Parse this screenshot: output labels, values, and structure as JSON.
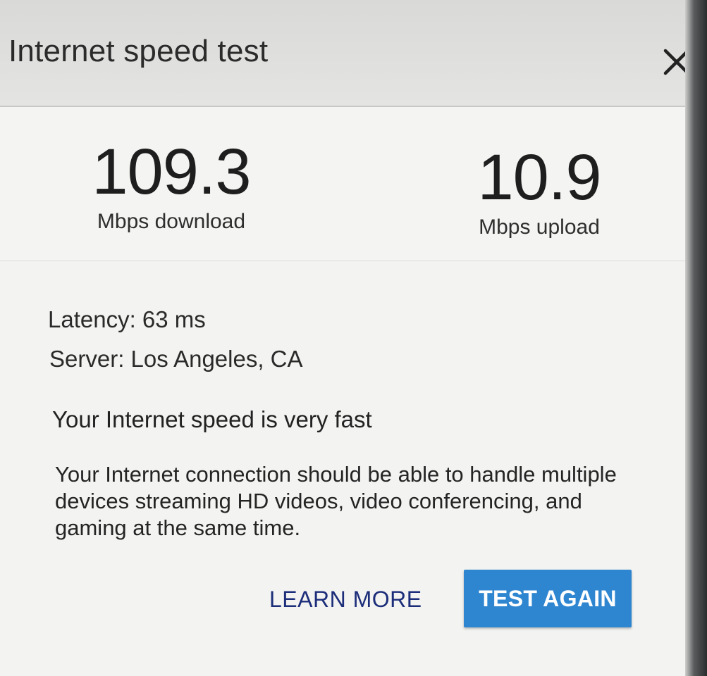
{
  "dialog": {
    "title": "Internet speed test",
    "close_icon": "close-icon"
  },
  "results": {
    "download": {
      "value": "109.3",
      "unit": "Mbps download"
    },
    "upload": {
      "value": "10.9",
      "unit": "Mbps upload"
    }
  },
  "details": {
    "latency": "Latency: 63 ms",
    "server": "Server: Los Angeles, CA",
    "verdict": "Your Internet speed is very fast",
    "description": "Your Internet connection should be able to handle multiple devices streaming HD videos, video conferencing, and gaming at the same time."
  },
  "actions": {
    "learn_more": "LEARN MORE",
    "test_again": "TEST AGAIN"
  },
  "colors": {
    "button_bg": "#2f86d0",
    "link": "#1c2d7a"
  }
}
